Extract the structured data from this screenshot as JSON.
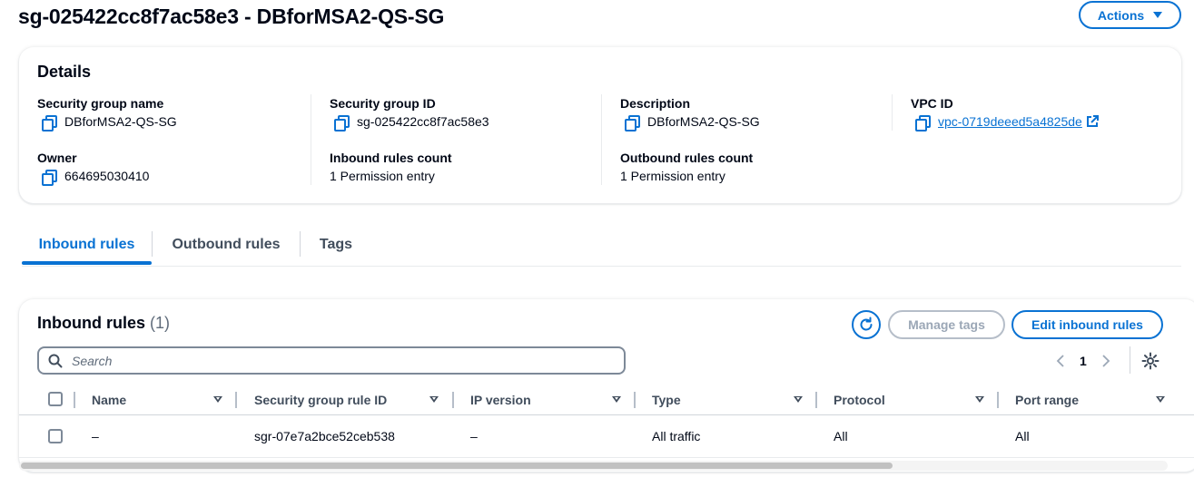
{
  "page": {
    "title": "sg-025422cc8f7ac58e3 - DBforMSA2-QS-SG",
    "actions_label": "Actions"
  },
  "details": {
    "heading": "Details",
    "security_group_name": {
      "label": "Security group name",
      "value": "DBforMSA2-QS-SG"
    },
    "security_group_id": {
      "label": "Security group ID",
      "value": "sg-025422cc8f7ac58e3"
    },
    "description": {
      "label": "Description",
      "value": "DBforMSA2-QS-SG"
    },
    "vpc_id": {
      "label": "VPC ID",
      "value": "vpc-0719deeed5a4825de"
    },
    "owner": {
      "label": "Owner",
      "value": "664695030410"
    },
    "inbound_rules_count": {
      "label": "Inbound rules count",
      "value": "1 Permission entry"
    },
    "outbound_rules_count": {
      "label": "Outbound rules count",
      "value": "1 Permission entry"
    }
  },
  "tabs": [
    {
      "label": "Inbound rules",
      "active": true
    },
    {
      "label": "Outbound rules",
      "active": false
    },
    {
      "label": "Tags",
      "active": false
    }
  ],
  "inbound": {
    "heading": "Inbound rules",
    "count": "(1)",
    "manage_tags_label": "Manage tags",
    "edit_label": "Edit inbound rules",
    "search_placeholder": "Search",
    "page_number": "1",
    "columns": [
      "Name",
      "Security group rule ID",
      "IP version",
      "Type",
      "Protocol",
      "Port range"
    ],
    "rows": [
      {
        "name": "–",
        "rule_id": "sgr-07e7a2bce52ceb538",
        "ip_version": "–",
        "type": "All traffic",
        "protocol": "All",
        "port_range": "All"
      }
    ]
  },
  "colors": {
    "accent": "#0972d3",
    "text": "#000716",
    "disabled": "#9ba7b6"
  },
  "icons": [
    "copy-icon",
    "external-link-icon",
    "refresh-icon",
    "search-icon",
    "chevron-left-icon",
    "chevron-right-icon",
    "settings-icon",
    "caret-down-icon"
  ]
}
